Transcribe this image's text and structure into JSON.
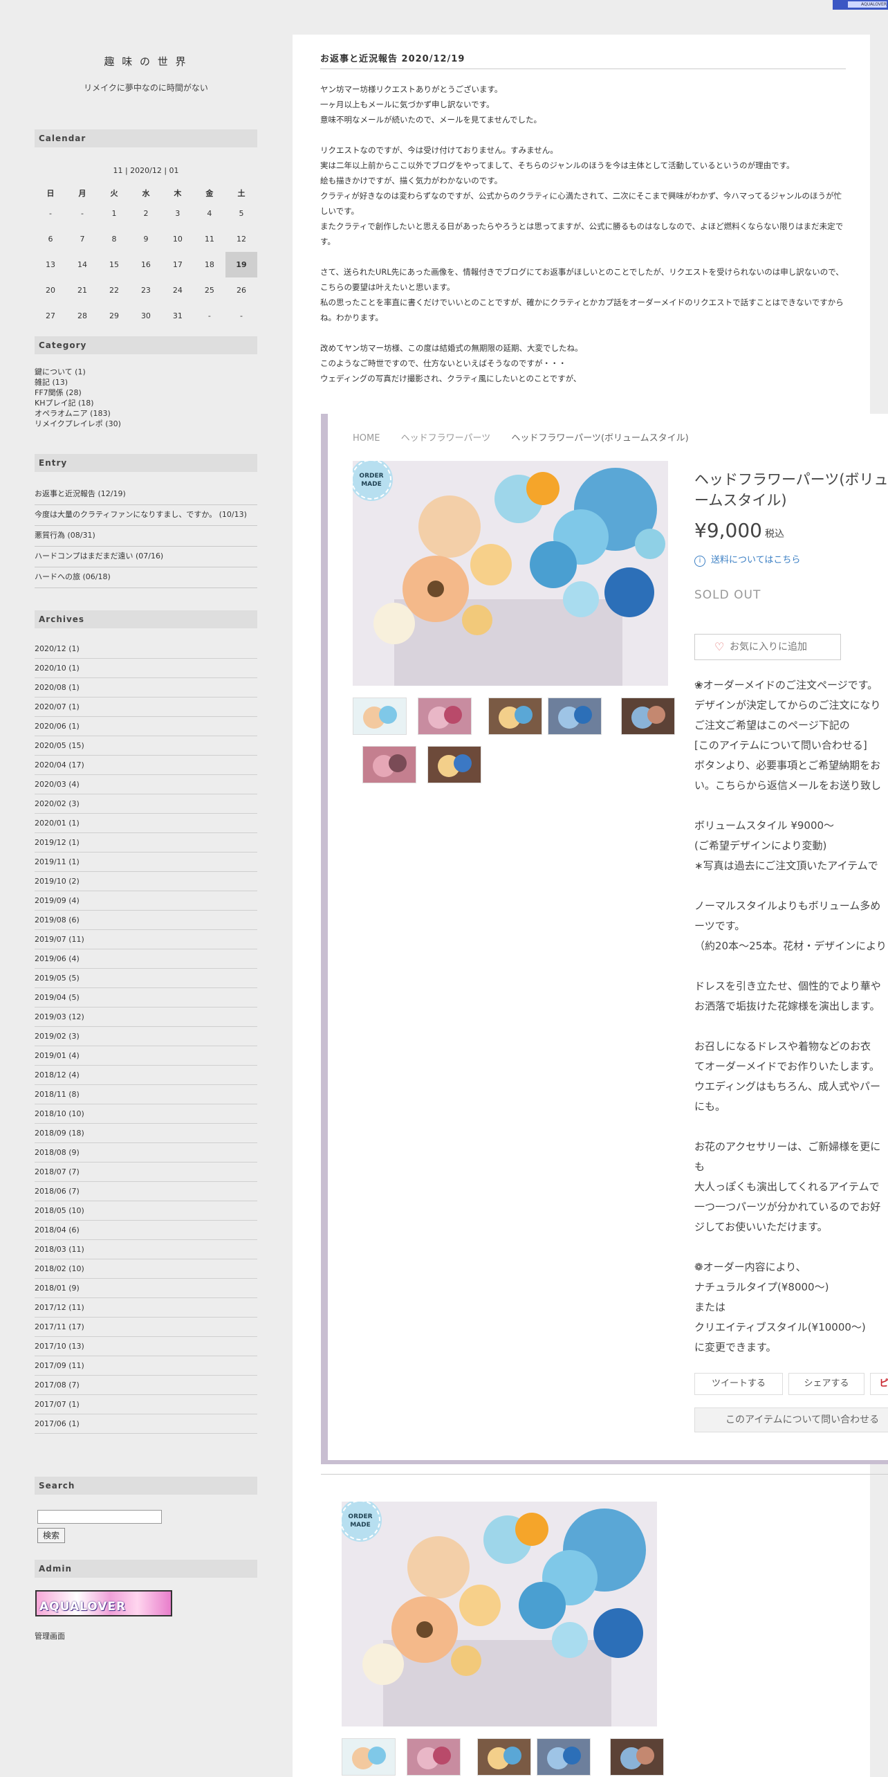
{
  "topbar": {
    "badge_text": "AQUALOVER"
  },
  "sidebar": {
    "site_title": "趣 味 の 世 界",
    "site_subtitle": "リメイクに夢中なのに時間がない",
    "calendar": {
      "heading": "Calendar",
      "nav": "11 | 2020/12 | 01",
      "weekdays": [
        "日",
        "月",
        "火",
        "水",
        "木",
        "金",
        "土"
      ],
      "weeks": [
        [
          "-",
          "-",
          "1",
          "2",
          "3",
          "4",
          "5"
        ],
        [
          "6",
          "7",
          "8",
          "9",
          "10",
          "11",
          "12"
        ],
        [
          "13",
          "14",
          "15",
          "16",
          "17",
          "18",
          "19"
        ],
        [
          "20",
          "21",
          "22",
          "23",
          "24",
          "25",
          "26"
        ],
        [
          "27",
          "28",
          "29",
          "30",
          "31",
          "-",
          "-"
        ]
      ],
      "today": "19"
    },
    "category": {
      "heading": "Category",
      "items": [
        "鍵について (1)",
        "雑記 (13)",
        "FF7関係 (28)",
        "KHプレイ記 (18)",
        "オペラオムニア (183)",
        "リメイクプレイレポ (30)"
      ]
    },
    "entry": {
      "heading": "Entry",
      "items": [
        "お返事と近況報告 (12/19)",
        "今度は大量のクラティファンになりすまし、ですか。 (10/13)",
        "悪質行為 (08/31)",
        "ハードコンプはまだまだ遠い (07/16)",
        "ハードへの旅 (06/18)"
      ]
    },
    "archives": {
      "heading": "Archives",
      "items": [
        "2020/12 (1)",
        "2020/10 (1)",
        "2020/08 (1)",
        "2020/07 (1)",
        "2020/06 (1)",
        "2020/05 (15)",
        "2020/04 (17)",
        "2020/03 (4)",
        "2020/02 (3)",
        "2020/01 (1)",
        "2019/12 (1)",
        "2019/11 (1)",
        "2019/10 (2)",
        "2019/09 (4)",
        "2019/08 (6)",
        "2019/07 (11)",
        "2019/06 (4)",
        "2019/05 (5)",
        "2019/04 (5)",
        "2019/03 (12)",
        "2019/02 (3)",
        "2019/01 (4)",
        "2018/12 (4)",
        "2018/11 (8)",
        "2018/10 (10)",
        "2018/09 (18)",
        "2018/08 (9)",
        "2018/07 (7)",
        "2018/06 (7)",
        "2018/05 (10)",
        "2018/04 (6)",
        "2018/03 (11)",
        "2018/02 (10)",
        "2018/01 (9)",
        "2017/12 (11)",
        "2017/11 (17)",
        "2017/10 (13)",
        "2017/09 (11)",
        "2017/08 (7)",
        "2017/07 (1)",
        "2017/06 (1)"
      ]
    },
    "search": {
      "heading": "Search",
      "value": "",
      "button_label": "検索"
    },
    "admin": {
      "heading": "Admin",
      "banner_text": "AQUALOVER",
      "link_label": "管理画面"
    }
  },
  "post": {
    "title": "お返事と近況報告 2020/12/19",
    "paragraphs": [
      [
        "ヤン坊マー坊様リクエストありがとうございます。",
        "一ヶ月以上もメールに気づかず申し訳ないです。",
        "意味不明なメールが続いたので、メールを見てませんでした。"
      ],
      [
        "リクエストなのですが、今は受け付けておりません。すみません。",
        "実は二年以上前からここ以外でブログをやってまして、そちらのジャンルのほうを今は主体として活動しているというのが理由です。",
        "絵も描きかけですが、描く気力がわかないのです。",
        "クラティが好きなのは変わらずなのですが、公式からのクラティに心満たされて、二次にそこまで興味がわかず、今ハマってるジャンルのほうが忙しいです。",
        "またクラティで創作したいと思える日があったらやろうとは思ってますが、公式に勝るものはなしなので、よほど燃料くならない限りはまだ未定です。"
      ],
      [
        "さて、送られたURL先にあった画像を、情報付きでブログにてお返事がほしいとのことでしたが、リクエストを受けられないのは申し訳ないので、こちらの要望は叶えたいと思います。",
        "私の思ったことを率直に書くだけでいいとのことですが、確かにクラティとかカプ話をオーダーメイドのリクエストで話すことはできないですからね。わかります。"
      ],
      [
        "改めてヤン坊マー坊様、この度は結婚式の無期限の延期、大変でしたね。",
        "このようなご時世ですので、仕方ないといえばそうなのですが・・・",
        "ウェディングの写真だけ撮影され、クラティ風にしたいとのことですが、"
      ]
    ]
  },
  "shop": {
    "breadcrumb": [
      "HOME",
      "ヘッドフラワーパーツ",
      "ヘッドフラワーパーツ(ボリュームスタイル)"
    ],
    "badge_lines": [
      "ORDER",
      "MADE"
    ],
    "product_name": "ヘッドフラワーパーツ(ボリュームスタイル)",
    "price": "¥9,000",
    "tax_label": "税込",
    "shipping_link": "送料についてはこちら",
    "status": "SOLD OUT",
    "favorite_label": "お気に入りに追加",
    "description": [
      [
        "❀オーダーメイドのご注文ページです。",
        "デザインが決定してからのご注文になり",
        "ご注文ご希望はこのページ下記の",
        "[このアイテムについて問い合わせる]",
        "ボタンより、必要事項とご希望納期をお",
        "い。こちらから返信メールをお送り致し"
      ],
      [
        "ボリュームスタイル ¥9000〜",
        "(ご希望デザインにより変動)",
        "∗写真は過去にご注文頂いたアイテムで"
      ],
      [
        "ノーマルスタイルよりもボリューム多め",
        "ーツです。",
        "（約20本〜25本。花材・デザインにより"
      ],
      [
        "ドレスを引き立たせ、個性的でより華や",
        "お洒落で垢抜けた花嫁様を演出します。"
      ],
      [
        "お召しになるドレスや着物などのお衣",
        "てオーダーメイドでお作りいたします。",
        "ウエディングはもちろん、成人式やパー",
        "にも。"
      ],
      [
        "お花のアクセサリーは、ご新婦様を更に",
        "も",
        "大人っぽくも演出してくれるアイテムで",
        "一つ一つパーツが分かれているのでお好",
        "ジしてお使いいただけます。"
      ],
      [
        "❁オーダー内容により、",
        "ナチュラルタイプ(¥8000〜)",
        "または",
        "クリエイティブスタイル(¥10000〜)",
        "に変更できます。"
      ]
    ],
    "share_buttons": [
      "ツイートする",
      "シェアする",
      "ピ"
    ],
    "ask_label": "このアイテムについて問い合わせる"
  },
  "colors": {
    "accent_blue": "#3b7fc4",
    "shop_frame": "#c8bed1",
    "sidebar_bg": "#ededed"
  }
}
